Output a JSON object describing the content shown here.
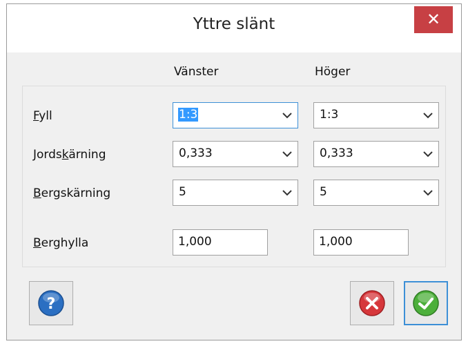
{
  "title": "Yttre slänt",
  "close_symbol": "✕",
  "columns": {
    "left": "Vänster",
    "right": "Höger"
  },
  "rows": [
    {
      "label_u": "F",
      "label_rest": "yll",
      "left": "1:3",
      "right": "1:3"
    },
    {
      "label_pre": "Jords",
      "label_u": "k",
      "label_rest": "ärning",
      "left": "0,333",
      "right": "0,333"
    },
    {
      "label_u": "B",
      "label_rest": "ergskärning",
      "left": "5",
      "right": "5"
    },
    {
      "label_u": "B",
      "label_rest": "erghylla",
      "left": "1,000",
      "right": "1,000"
    }
  ],
  "icons": {
    "help": "question-mark",
    "cancel": "red-x",
    "ok": "green-check",
    "dropdown": "chevron-down"
  },
  "colors": {
    "accent": "#3c8fd6",
    "close": "#c74044",
    "help": "#2b6fc2",
    "cancel": "#d6373b",
    "ok": "#4caf3a"
  }
}
